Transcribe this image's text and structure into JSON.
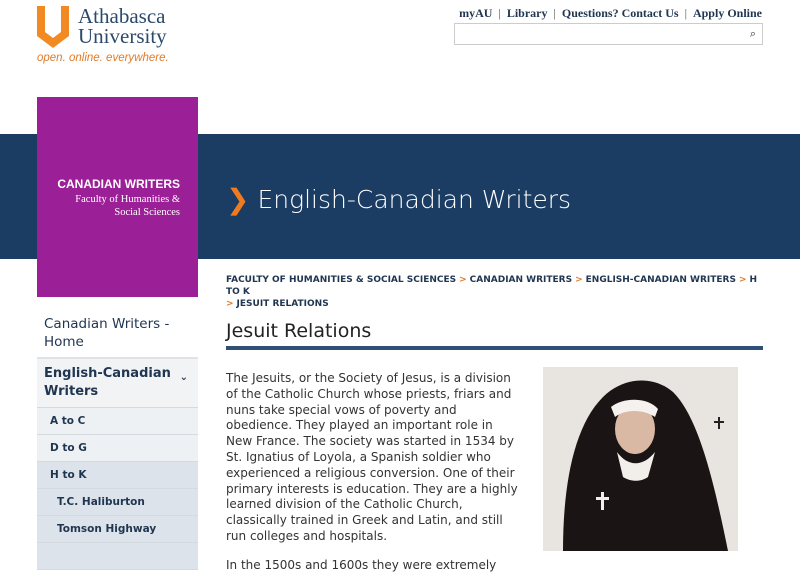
{
  "header": {
    "logo_line1": "Athabasca",
    "logo_line2": "University",
    "tagline": "open. online. everywhere.",
    "links": [
      "myAU",
      "Library",
      "Questions? Contact Us",
      "Apply Online"
    ],
    "search_placeholder": ""
  },
  "banner": {
    "section": "CANADIAN WRITERS",
    "faculty": "Faculty of Humanities & Social Sciences",
    "title": "English-Canadian Writers"
  },
  "breadcrumb": [
    "FACULTY OF HUMANITIES & SOCIAL SCIENCES",
    "CANADIAN WRITERS",
    "ENGLISH-CANADIAN WRITERS",
    "H TO K",
    "JESUIT RELATIONS"
  ],
  "sidebar": {
    "home": "Canadian Writers - Home",
    "section": "English-Canadian Writers",
    "items": [
      "A to C",
      "D to G",
      "H to K"
    ],
    "subitems": [
      "T.C. Haliburton",
      "Tomson Highway"
    ]
  },
  "main": {
    "title": "Jesuit Relations",
    "p1": "The Jesuits, or the Society of Jesus, is a division of the Catholic Church whose priests, friars and nuns take special vows of poverty and obedience. They played an important role in New France. The society was started in 1534 by St. Ignatius of Loyola, a Spanish soldier who experienced a religious conversion. One of their primary interests is education. They are a highly learned division of the Catholic Church, classically trained in Greek and Latin, and still run colleges and hospitals.",
    "p2": "In the 1500s and 1600s they were extremely"
  }
}
